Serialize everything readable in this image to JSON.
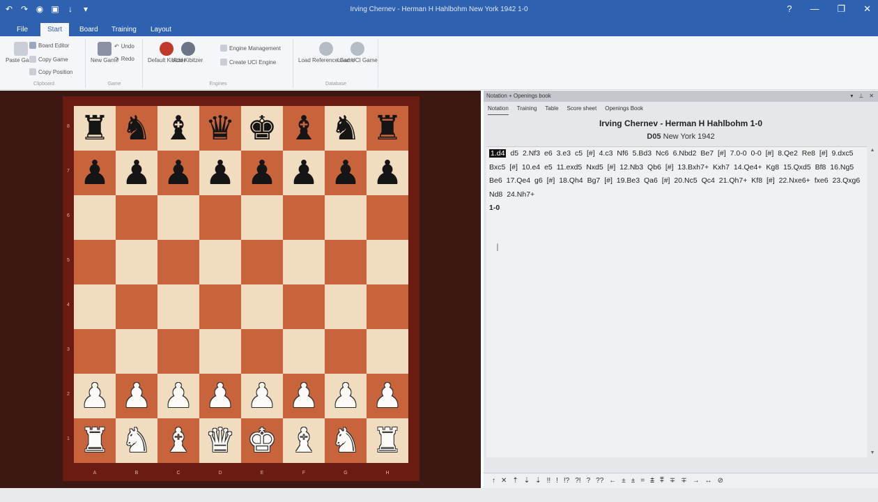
{
  "window": {
    "title": "Irving Chernev - Herman H Hahlbohm  New York 1942  1-0",
    "controls": [
      "?",
      "—",
      "❐",
      "✕"
    ]
  },
  "quick_access": [
    {
      "icon": "undo-icon",
      "glyph": "↶"
    },
    {
      "icon": "redo-icon",
      "glyph": "↷"
    },
    {
      "icon": "globe-icon",
      "glyph": "◉"
    },
    {
      "icon": "save-icon",
      "glyph": "▣"
    },
    {
      "icon": "arrow-icon",
      "glyph": "↓"
    },
    {
      "icon": "menu-icon",
      "glyph": "▾"
    }
  ],
  "ribbon_tabs": [
    "File",
    "Start",
    "Board",
    "Training",
    "Layout"
  ],
  "active_tab": "Start",
  "ribbon": {
    "clipboard": {
      "paste": "Paste Game",
      "items": [
        "Board Editor",
        "Copy Game",
        "Copy Position"
      ],
      "label": "Clipboard"
    },
    "new_game": "New Game",
    "extra": [
      "Undo",
      "Redo"
    ],
    "engines": [
      "Default Kibitzer",
      "Add Kibitzer"
    ],
    "misc": [
      "Engine Management",
      "Create UCI Engine"
    ],
    "openings": [
      "Load Reference Game",
      "Load UCI Game"
    ],
    "group_labels": [
      "Clipboard",
      "Game",
      "Engines",
      "Database"
    ]
  },
  "board": {
    "ranks": [
      "8",
      "7",
      "6",
      "5",
      "4",
      "3",
      "2",
      "1"
    ],
    "files": [
      "A",
      "B",
      "C",
      "D",
      "E",
      "F",
      "G",
      "H"
    ],
    "rows": [
      [
        "bR",
        "bN",
        "bB",
        "bQ",
        "bK",
        "bB",
        "bN",
        "bR"
      ],
      [
        "bP",
        "bP",
        "bP",
        "bP",
        "bP",
        "bP",
        "bP",
        "bP"
      ],
      [
        "",
        "",
        "",
        "",
        "",
        "",
        "",
        ""
      ],
      [
        "",
        "",
        "",
        "",
        "",
        "",
        "",
        ""
      ],
      [
        "",
        "",
        "",
        "",
        "",
        "",
        "",
        ""
      ],
      [
        "",
        "",
        "",
        "",
        "",
        "",
        "",
        ""
      ],
      [
        "wP",
        "wP",
        "wP",
        "wP",
        "wP",
        "wP",
        "wP",
        "wP"
      ],
      [
        "wR",
        "wN",
        "wB",
        "wQ",
        "wK",
        "wB",
        "wN",
        "wR"
      ]
    ],
    "colors": {
      "light": "#f1dcc0",
      "dark": "#c8643b",
      "frame": "#6a1c12",
      "surround": "#3d1812"
    }
  },
  "notation_panel": {
    "header": "Notation + Openings book",
    "tabs": [
      "Notation",
      "Training",
      "Table",
      "Score sheet",
      "Openings Book"
    ],
    "active_tab": "Notation",
    "players": "Irving Chernev - Herman H Hahlbohm  1-0",
    "eco": "D05",
    "event": "New York 1942",
    "moves": [
      "1.d4",
      "d5",
      "2.Nf3",
      "e6",
      "3.e3",
      "c5",
      "[#]",
      "4.c3",
      "Nf6",
      "5.Bd3",
      "Nc6",
      "6.Nbd2",
      "Be7",
      "[#]",
      "7.0-0",
      "0-0",
      "[#]",
      "8.Qe2",
      "Re8",
      "[#]",
      "9.dxc5",
      "Bxc5",
      "[#]",
      "10.e4",
      "e5",
      "11.exd5",
      "Nxd5",
      "[#]",
      "12.Nb3",
      "Qb6",
      "[#]",
      "13.Bxh7+",
      "Kxh7",
      "14.Qe4+",
      "Kg8",
      "15.Qxd5",
      "Bf8",
      "16.Ng5",
      "Be6",
      "17.Qe4",
      "g6",
      "[#]",
      "18.Qh4",
      "Bg7",
      "[#]",
      "19.Be3",
      "Qa6",
      "[#]",
      "20.Nc5",
      "Qc4",
      "21.Qh7+",
      "Kf8",
      "[#]",
      "22.Nxe6+",
      "fxe6",
      "23.Qxg6",
      "Nd8",
      "24.Nh7+"
    ],
    "current_move": 0,
    "result": "1-0",
    "toolbar": [
      "↑",
      "✕",
      "⇡",
      "⇣",
      "⇣",
      "!!",
      "!",
      "!?",
      "?!",
      "?",
      "??",
      "←",
      "±",
      "±",
      "=",
      "⩲",
      "⩱",
      "∓",
      "∓",
      "→",
      "↔",
      "⊘"
    ]
  }
}
